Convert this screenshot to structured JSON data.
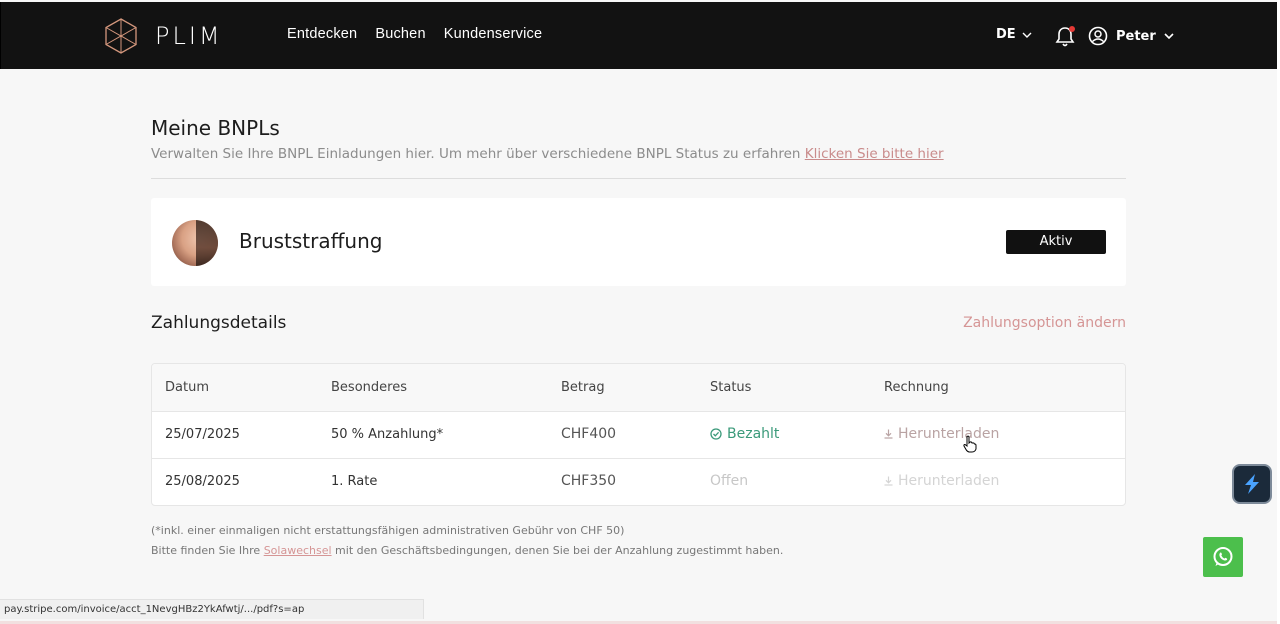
{
  "header": {
    "brand": "PLIM",
    "nav": [
      "Entdecken",
      "Buchen",
      "Kundenservice"
    ],
    "language": "DE",
    "user": "Peter"
  },
  "page": {
    "title": "Meine BNPLs",
    "subtitle": "Verwalten Sie Ihre BNPL Einladungen hier. Um mehr über verschiedene BNPL Status zu erfahren",
    "subtitle_link": "Klicken Sie bitte hier"
  },
  "card": {
    "title": "Bruststraffung",
    "status": "Aktiv"
  },
  "payment": {
    "title": "Zahlungsdetails",
    "action": "Zahlungsoption ändern",
    "columns": [
      "Datum",
      "Besonderes",
      "Betrag",
      "Status",
      "Rechnung"
    ],
    "rows": [
      {
        "date": "25/07/2025",
        "note": "50 % Anzahlung*",
        "amount": "CHF400",
        "status": "Bezahlt",
        "invoice": "Herunterladen"
      },
      {
        "date": "25/08/2025",
        "note": "1. Rate",
        "amount": "CHF350",
        "status": "Offen",
        "invoice": "Herunterladen"
      }
    ]
  },
  "notes": {
    "fee": "(*inkl. einer einmaligen nicht erstattungsfähigen administrativen Gebühr von CHF 50)",
    "terms_before": "Bitte finden Sie Ihre ",
    "terms_link": "Solawechsel",
    "terms_after": " mit den Geschäftsbedingungen, denen Sie bei der Anzahlung zugestimmt haben."
  },
  "statusbar": {
    "url": "pay.stripe.com/invoice/acct_1NevgHBz2YkAfwtj/.../pdf?s=ap"
  },
  "colors": {
    "header_bg": "#121212",
    "accent": "#d59595",
    "paid": "#3b9a7a",
    "whatsapp": "#4cbf4c"
  }
}
